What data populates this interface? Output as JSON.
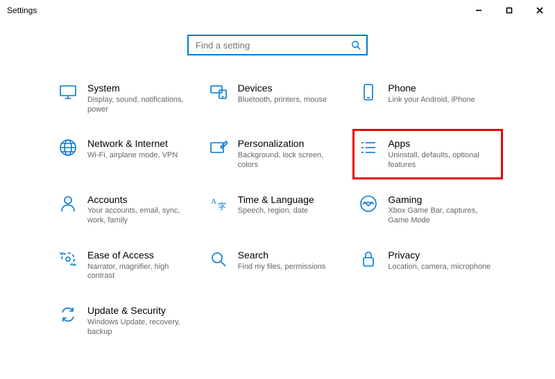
{
  "window": {
    "title": "Settings"
  },
  "search": {
    "placeholder": "Find a setting"
  },
  "items": {
    "system": {
      "title": "System",
      "desc": "Display, sound, notifications, power"
    },
    "devices": {
      "title": "Devices",
      "desc": "Bluetooth, printers, mouse"
    },
    "phone": {
      "title": "Phone",
      "desc": "Link your Android, iPhone"
    },
    "network": {
      "title": "Network & Internet",
      "desc": "Wi-Fi, airplane mode, VPN"
    },
    "personalization": {
      "title": "Personalization",
      "desc": "Background, lock screen, colors"
    },
    "apps": {
      "title": "Apps",
      "desc": "Uninstall, defaults, optional features"
    },
    "accounts": {
      "title": "Accounts",
      "desc": "Your accounts, email, sync, work, family"
    },
    "time": {
      "title": "Time & Language",
      "desc": "Speech, region, date"
    },
    "gaming": {
      "title": "Gaming",
      "desc": "Xbox Game Bar, captures, Game Mode"
    },
    "ease": {
      "title": "Ease of Access",
      "desc": "Narrator, magnifier, high contrast"
    },
    "search_cat": {
      "title": "Search",
      "desc": "Find my files, permissions"
    },
    "privacy": {
      "title": "Privacy",
      "desc": "Location, camera, microphone"
    },
    "update": {
      "title": "Update & Security",
      "desc": "Windows Update, recovery, backup"
    }
  }
}
